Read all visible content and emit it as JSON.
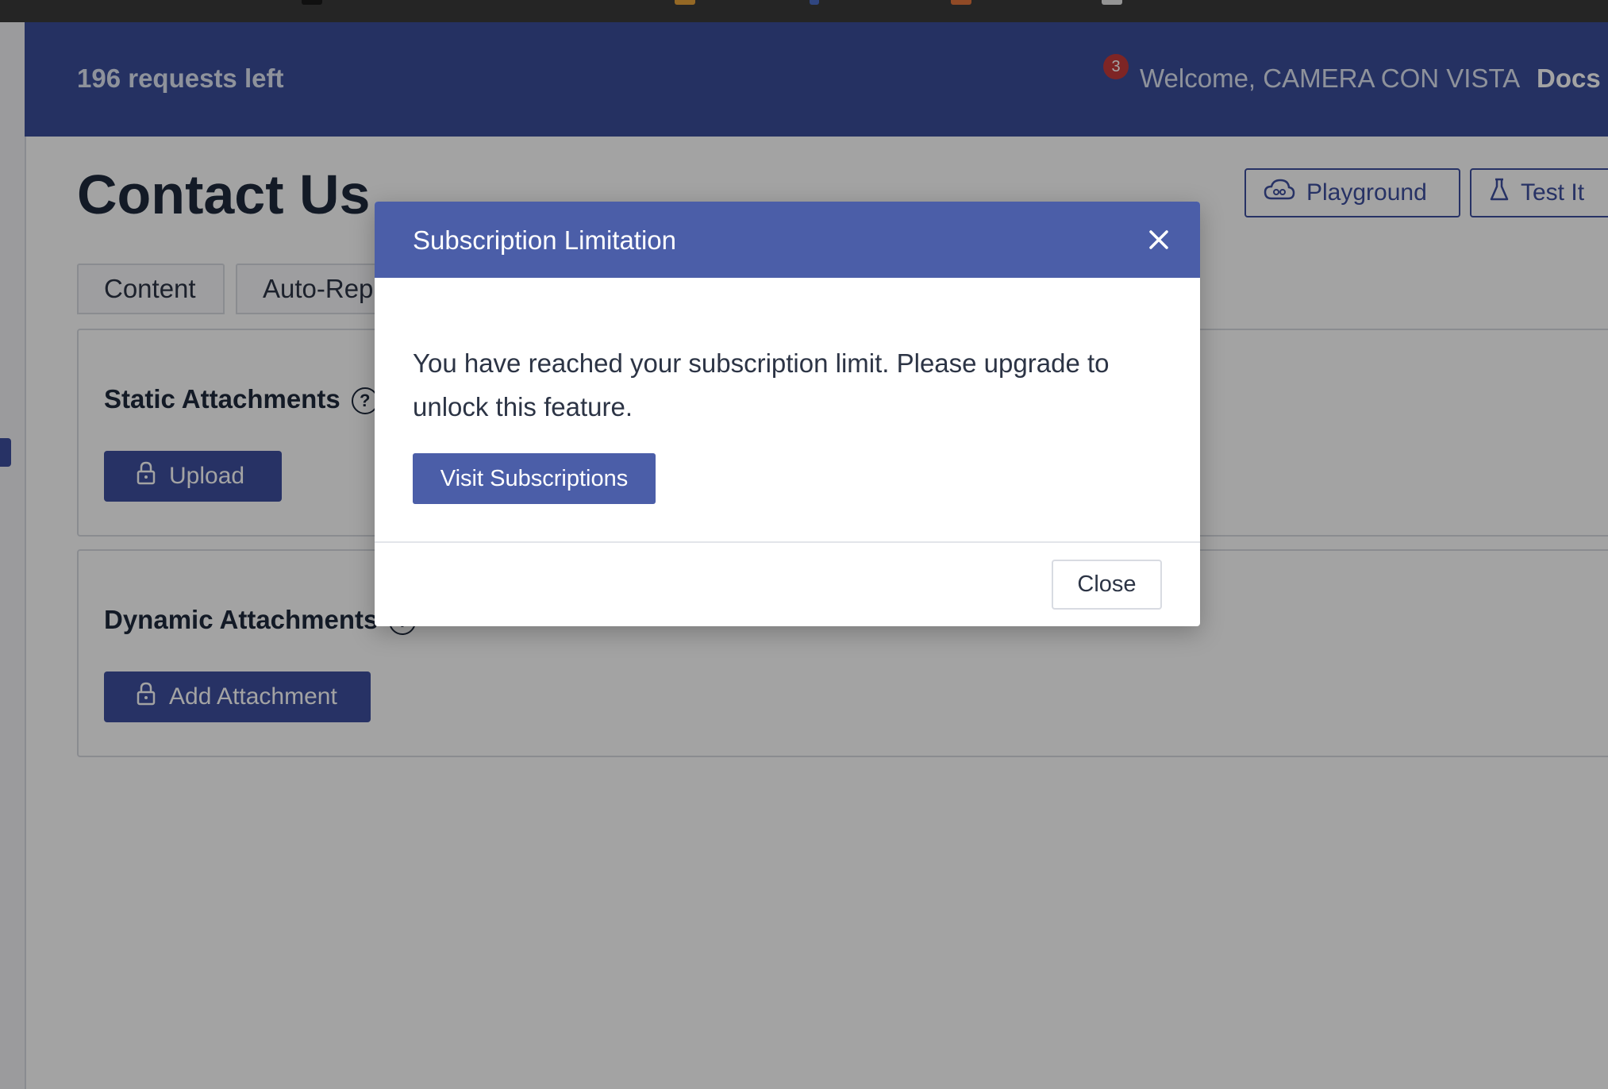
{
  "header": {
    "requests_left": "196 requests left",
    "notification_count": "3",
    "welcome": "Welcome,  CAMERA CON VISTA",
    "docs_label": "Docs"
  },
  "page": {
    "title": "Contact Us",
    "buttons": {
      "playground": "Playground",
      "test_it": "Test It"
    },
    "tabs": [
      "Content",
      "Auto-Repl"
    ]
  },
  "sections": {
    "static": {
      "title": "Static Attachments",
      "button": "Upload"
    },
    "dynamic": {
      "title": "Dynamic Attachments",
      "button": "Add Attachment"
    }
  },
  "modal": {
    "title": "Subscription Limitation",
    "message": "You have reached your subscription limit. Please upgrade to unlock this feature.",
    "visit_button": "Visit Subscriptions",
    "close_button": "Close"
  },
  "icons": {
    "help": "question-circle-icon",
    "lock": "lock-icon",
    "cloud": "cloud-icon",
    "flask": "flask-icon",
    "close": "close-x-icon"
  },
  "colors": {
    "brand": "#3b4e9a",
    "modal_header": "#4b5ea8",
    "notification_badge": "#c53a3a"
  }
}
